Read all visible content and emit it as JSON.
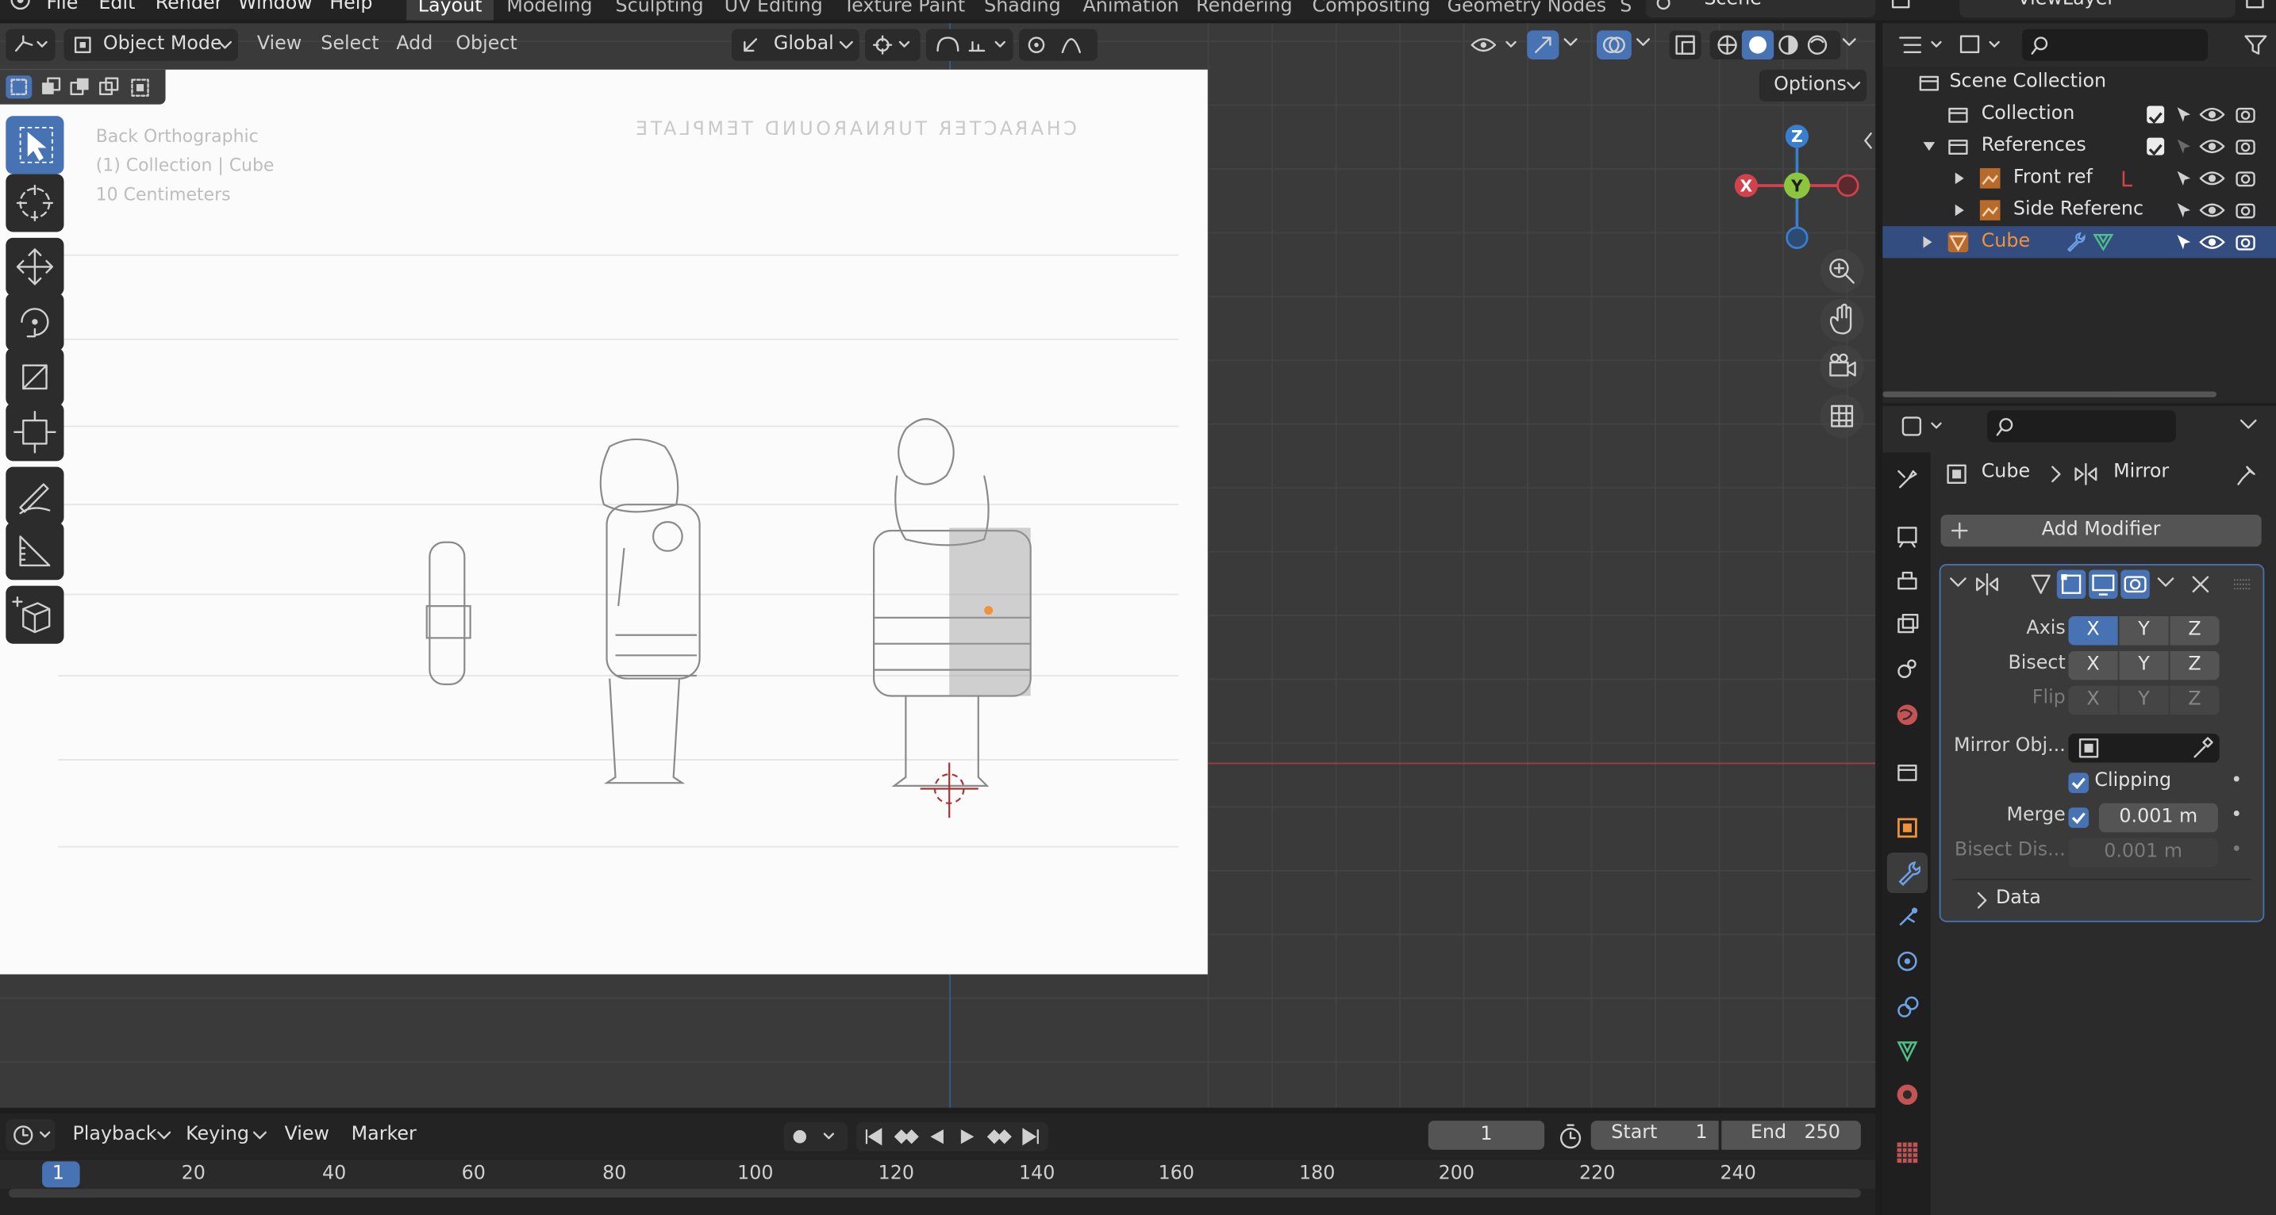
{
  "menu": [
    "File",
    "Edit",
    "Render",
    "Window",
    "Help"
  ],
  "workspace_tabs": [
    "Layout",
    "Modeling",
    "Sculpting",
    "UV Editing",
    "Texture Paint",
    "Shading",
    "Animation",
    "Rendering",
    "Compositing",
    "Geometry Nodes",
    "S"
  ],
  "active_tab": "Layout",
  "scene_name": "Scene",
  "view_layer": "ViewLayer",
  "viewport": {
    "mode": "Object Mode",
    "header_menus": [
      "View",
      "Select",
      "Add",
      "Object"
    ],
    "orientation": "Global",
    "options": "Options",
    "overlay_text": [
      "Back Orthographic",
      "(1) Collection | Cube",
      "10 Centimeters"
    ],
    "gizmo_axes": {
      "z": "Z",
      "x": "X",
      "y": "Y"
    },
    "reference_caption": "CHARACTER TURNAROUND TEMPLATE"
  },
  "outliner": {
    "root": "Scene Collection",
    "rows": [
      {
        "label": "Collection"
      },
      {
        "label": "References"
      },
      {
        "label": "Front ref"
      },
      {
        "label": "Side Referenc"
      },
      {
        "label": "Cube"
      }
    ]
  },
  "properties": {
    "breadcrumb_object": "Cube",
    "breadcrumb_modifier": "Mirror",
    "add_modifier": "Add Modifier",
    "axis_label": "Axis",
    "bisect_label": "Bisect",
    "flip_label": "Flip",
    "axes": [
      "X",
      "Y",
      "Z"
    ],
    "axis_state": [
      true,
      false,
      false
    ],
    "mirror_object_label": "Mirror Obj...",
    "clipping_label": "Clipping",
    "clipping_checked": true,
    "merge_label": "Merge",
    "merge_checked": true,
    "merge_value": "0.001 m",
    "bisect_distance_label": "Bisect Dis...",
    "bisect_distance_value": "0.001 m",
    "data_label": "Data"
  },
  "timeline": {
    "menus": [
      "Playback",
      "Keying",
      "View",
      "Marker"
    ],
    "current_frame": "1",
    "start_label": "Start",
    "start_value": "1",
    "end_label": "End",
    "end_value": "250",
    "ticks": [
      "1",
      "20",
      "40",
      "60",
      "80",
      "100",
      "120",
      "140",
      "160",
      "180",
      "200",
      "220",
      "240"
    ]
  },
  "colors": {
    "accent": "#4772b3",
    "axis_x": "#d2424d",
    "axis_y": "#8cc63e",
    "axis_z": "#3a7ed0",
    "object_orange": "#f0923a"
  }
}
